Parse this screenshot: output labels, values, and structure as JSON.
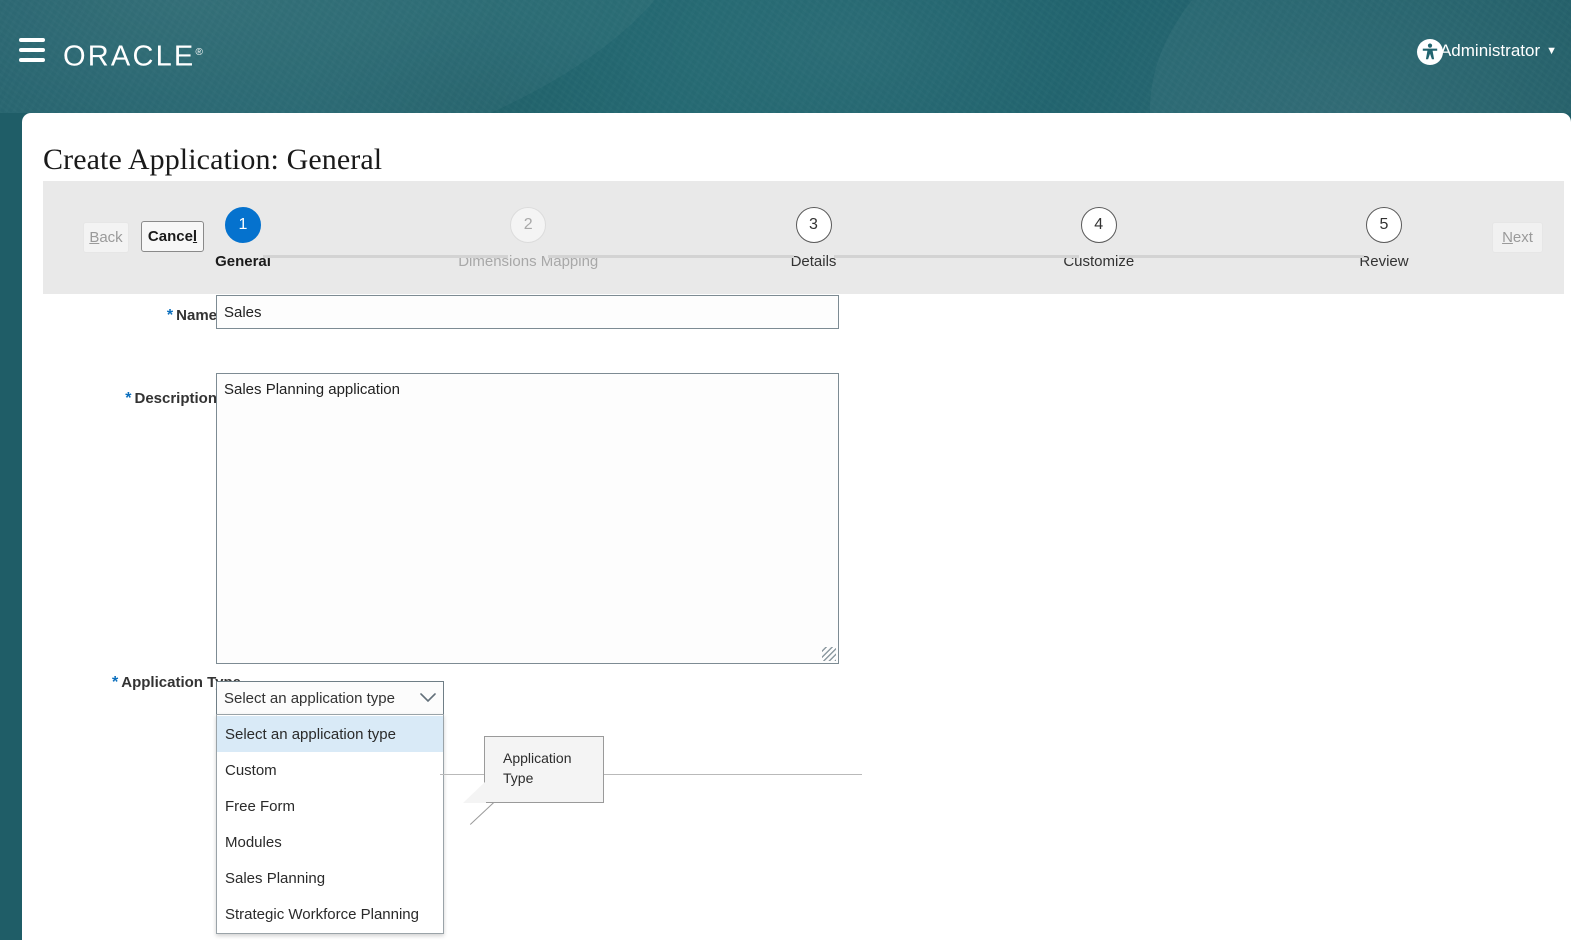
{
  "banner": {
    "menu_icon": "hamburger-menu-icon",
    "logo_text": "ORACLE",
    "logo_mark": "®",
    "accessibility_icon": "accessibility-person-icon",
    "user_name": "Administrator",
    "user_caret": "▼",
    "background_color": "#22646f"
  },
  "page": {
    "title": "Create Application: General"
  },
  "toolbar": {
    "back_label": "Back",
    "back_mnemonic": "B",
    "back_disabled": true,
    "cancel_label": "Cance",
    "cancel_mnemonic": "l",
    "cancel_disabled": false,
    "next_label": "Next",
    "next_mnemonic": "N",
    "next_disabled": true
  },
  "train": {
    "steps": [
      {
        "number": "1",
        "label": "General",
        "state": "current"
      },
      {
        "number": "2",
        "label": "Dimensions Mapping",
        "state": "disabled"
      },
      {
        "number": "3",
        "label": "Details",
        "state": "todo"
      },
      {
        "number": "4",
        "label": "Customize",
        "state": "todo"
      },
      {
        "number": "5",
        "label": "Review",
        "state": "todo"
      }
    ],
    "current_color": "#0572ce"
  },
  "form": {
    "required_marker": "*",
    "required_color": "#0a6ebd",
    "name": {
      "label": "Name",
      "value": "Sales",
      "placeholder": ""
    },
    "description": {
      "label": "Description",
      "value": "Sales Planning application",
      "placeholder": ""
    },
    "application_type": {
      "label": "Application Type",
      "selected": "Select an application type",
      "chevron_icon": "chevron-down-icon",
      "expanded": true,
      "options": [
        "Select an application type",
        "Custom",
        "Free Form",
        "Modules",
        "Sales Planning",
        "Strategic Workforce Planning"
      ],
      "highlighted_index": 0,
      "highlight_color": "#d9eaf7",
      "tooltip": "Application Type"
    }
  }
}
